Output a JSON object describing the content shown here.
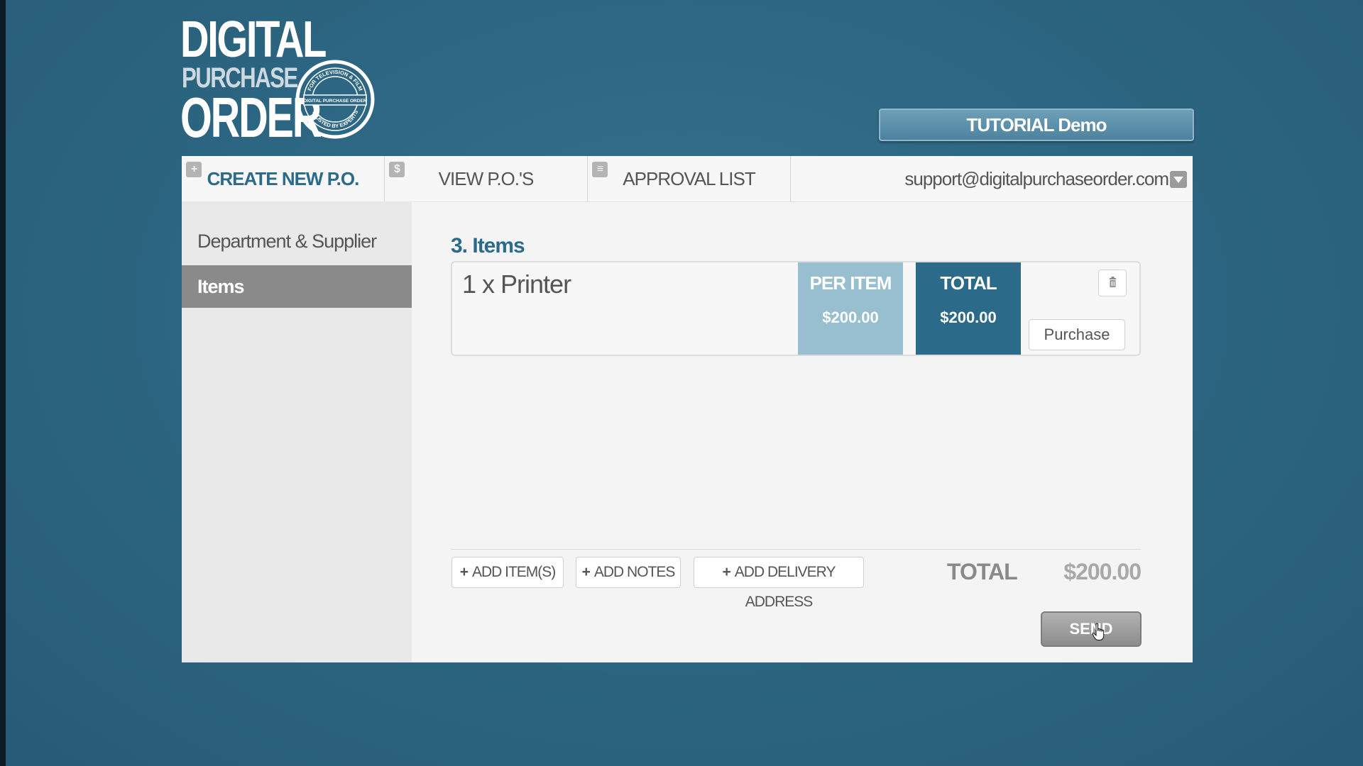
{
  "logo": {
    "line1": "DIGITAL",
    "line2": "PURCHASE",
    "line3": "ORDER",
    "seal_top": "FOR TELEVISION & FILM",
    "seal_middle": "DIGITAL PURCHASE ORDER",
    "seal_bottom": "TRUSTED BY EXPERTS"
  },
  "header": {
    "tutorial_label": "TUTORIAL Demo"
  },
  "nav": {
    "tabs": [
      {
        "label": "CREATE NEW P.O.",
        "icon": "plus-icon",
        "glyph": "+"
      },
      {
        "label": "VIEW P.O.'S",
        "icon": "dollar-icon",
        "glyph": "$"
      },
      {
        "label": "APPROVAL LIST",
        "icon": "list-icon",
        "glyph": "≡"
      }
    ],
    "user_email": "support@digitalpurchaseorder.com"
  },
  "sidebar": {
    "items": [
      {
        "label": "Department & Supplier"
      },
      {
        "label": "Items"
      }
    ]
  },
  "content": {
    "section_title": "3. Items",
    "item": {
      "description": "1 x Printer",
      "per_item_label": "PER ITEM",
      "per_item_value": "$200.00",
      "total_label": "TOTAL",
      "total_value": "$200.00",
      "purchase_label": "Purchase"
    },
    "actions": {
      "add_items": "ADD ITEM(S)",
      "add_notes": "ADD NOTES",
      "add_delivery": "ADD DELIVERY ADDRESS"
    },
    "summary": {
      "total_label": "TOTAL",
      "total_value": "$200.00"
    },
    "send_label": "SEND"
  },
  "colors": {
    "background": "#2d6783",
    "accent": "#2c6a89",
    "per_item": "#98bfd0"
  }
}
